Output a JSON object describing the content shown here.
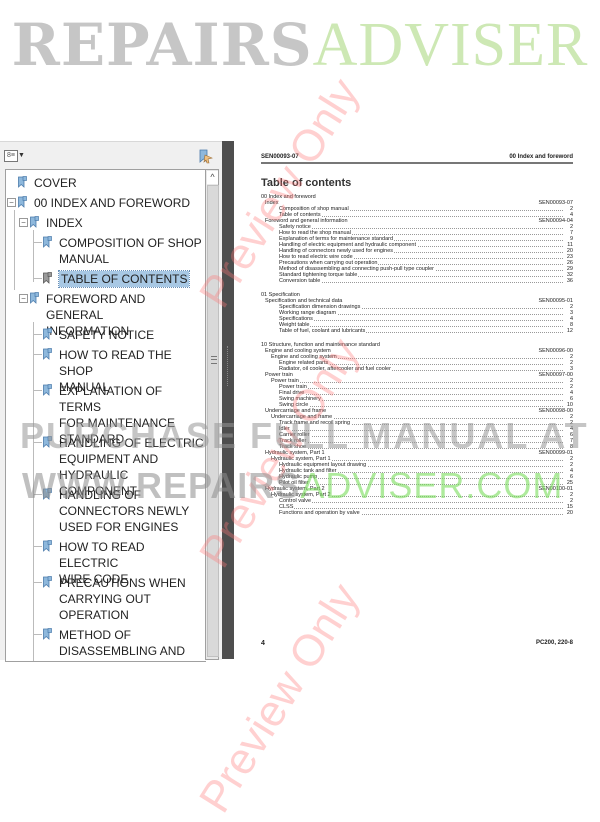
{
  "brand": {
    "part1": "REPAIRS",
    "part2": "ADVISER"
  },
  "watermarks": {
    "preview": "Preview Only",
    "purchase": "PURCHASE FULL MANUAL AT",
    "site_part1": "WWW.REPAIRS",
    "site_part2": "ADVISER.COM"
  },
  "bookmarks_panel": {
    "options_icon": "options-menu-icon",
    "tool_icon": "bookmark-tool-icon",
    "items": [
      {
        "label": "COVER",
        "level": 0
      },
      {
        "label": "00 INDEX AND FOREWORD",
        "level": 0,
        "expanded": true
      },
      {
        "label": "INDEX",
        "level": 1,
        "expanded": true
      },
      {
        "label": "COMPOSITION OF SHOP\nMANUAL",
        "level": 2
      },
      {
        "label": "TABLE OF CONTENTS",
        "level": 2,
        "selected": true
      },
      {
        "label": "FOREWORD AND GENERAL\nINFORMATION",
        "level": 1,
        "expanded": true
      },
      {
        "label": "SAFETY NOTICE",
        "level": 2
      },
      {
        "label": "HOW TO READ THE SHOP\nMANUAL",
        "level": 2
      },
      {
        "label": "EXPLANATION OF TERMS\nFOR MAINTENANCE\nSTANDARD",
        "level": 2
      },
      {
        "label": "HANDLING OF ELECTRIC\nEQUIPMENT AND\nHYDRAULIC COMPONENT",
        "level": 2
      },
      {
        "label": "HANDLING OF\nCONNECTORS NEWLY\nUSED FOR ENGINES",
        "level": 2
      },
      {
        "label": "HOW TO READ ELECTRIC\nWIRE CODE",
        "level": 2
      },
      {
        "label": "PRECAUTIONS WHEN\nCARRYING OUT\nOPERATION",
        "level": 2
      },
      {
        "label": "METHOD OF\nDISASSEMBLING AND",
        "level": 2
      }
    ]
  },
  "document": {
    "header_left": "SEN00093-07",
    "header_right": "00 Index and foreword",
    "title": "Table of contents",
    "footer_page": "4",
    "footer_model": "PC200, 220-8",
    "toc": [
      {
        "type": "section",
        "text": "00 Index and foreword"
      },
      {
        "type": "group",
        "text": "Index",
        "code": "SEN00093-07"
      },
      {
        "type": "entry",
        "indent": 2,
        "text": "Composition of shop manual",
        "page": "2"
      },
      {
        "type": "entry",
        "indent": 2,
        "text": "Table of contents",
        "page": "4"
      },
      {
        "type": "group",
        "text": "Foreword and general information",
        "code": "SEN00094-04"
      },
      {
        "type": "entry",
        "indent": 2,
        "text": "Safety notice",
        "page": "2"
      },
      {
        "type": "entry",
        "indent": 2,
        "text": "How to read the shop manual",
        "page": "7"
      },
      {
        "type": "entry",
        "indent": 2,
        "text": "Explanation of terms for maintenance standard",
        "page": "9"
      },
      {
        "type": "entry",
        "indent": 2,
        "text": "Handling of electric equipment and hydraulic component",
        "page": "11"
      },
      {
        "type": "entry",
        "indent": 2,
        "text": "Handling of connectors newly used for engines",
        "page": "20"
      },
      {
        "type": "entry",
        "indent": 2,
        "text": "How to read electric wire code",
        "page": "23"
      },
      {
        "type": "entry",
        "indent": 2,
        "text": "Precautions when carrying out operation",
        "page": "26"
      },
      {
        "type": "entry",
        "indent": 2,
        "text": "Method of disassembling and connecting push-pull type coupler",
        "page": "29"
      },
      {
        "type": "entry",
        "indent": 2,
        "text": "Standard tightening torque table",
        "page": "32"
      },
      {
        "type": "entry",
        "indent": 2,
        "text": "Conversion table",
        "page": "36"
      },
      {
        "type": "gap"
      },
      {
        "type": "section",
        "text": "01 Specification"
      },
      {
        "type": "group",
        "text": "Specification and technical data",
        "code": "SEN00095-01"
      },
      {
        "type": "entry",
        "indent": 2,
        "text": "Specification dimension drawings",
        "page": "2"
      },
      {
        "type": "entry",
        "indent": 2,
        "text": "Working range diagram",
        "page": "3"
      },
      {
        "type": "entry",
        "indent": 2,
        "text": "Specifications",
        "page": "4"
      },
      {
        "type": "entry",
        "indent": 2,
        "text": "Weight table",
        "page": "8"
      },
      {
        "type": "entry",
        "indent": 2,
        "text": "Table of fuel, coolant and lubricants",
        "page": "12"
      },
      {
        "type": "gap"
      },
      {
        "type": "section",
        "text": "10 Structure, function and maintenance standard"
      },
      {
        "type": "group",
        "text": "Engine and cooling system",
        "code": "SEN00096-00"
      },
      {
        "type": "entry",
        "indent": 1,
        "text": "Engine and cooling system",
        "page": "2"
      },
      {
        "type": "entry",
        "indent": 2,
        "text": "Engine related parts",
        "page": "2"
      },
      {
        "type": "entry",
        "indent": 2,
        "text": "Radiator, oil cooler, aftercooler and fuel cooler",
        "page": "3"
      },
      {
        "type": "group",
        "text": "Power train",
        "code": "SEN00097-00"
      },
      {
        "type": "entry",
        "indent": 1,
        "text": "Power train",
        "page": "2"
      },
      {
        "type": "entry",
        "indent": 2,
        "text": "Power train",
        "page": "2"
      },
      {
        "type": "entry",
        "indent": 2,
        "text": "Final drive",
        "page": "4"
      },
      {
        "type": "entry",
        "indent": 2,
        "text": "Swing machinery",
        "page": "6"
      },
      {
        "type": "entry",
        "indent": 2,
        "text": "Swing circle",
        "page": "10"
      },
      {
        "type": "group",
        "text": "Undercarriage and frame",
        "code": "SEN00098-00"
      },
      {
        "type": "entry",
        "indent": 1,
        "text": "Undercarriage and frame",
        "page": "2"
      },
      {
        "type": "entry",
        "indent": 2,
        "text": "Track frame and recoil spring",
        "page": "2"
      },
      {
        "type": "entry",
        "indent": 2,
        "text": "Idler",
        "page": "4"
      },
      {
        "type": "entry",
        "indent": 2,
        "text": "Carrier roller",
        "page": "6"
      },
      {
        "type": "entry",
        "indent": 2,
        "text": "Track roller",
        "page": "7"
      },
      {
        "type": "entry",
        "indent": 2,
        "text": "Track shoe",
        "page": "8"
      },
      {
        "type": "group",
        "text": "Hydraulic system, Part 1",
        "code": "SEN00099-01"
      },
      {
        "type": "entry",
        "indent": 1,
        "text": "Hydraulic system, Part 1",
        "page": "2"
      },
      {
        "type": "entry",
        "indent": 2,
        "text": "Hydraulic equipment layout drawing",
        "page": "2"
      },
      {
        "type": "entry",
        "indent": 2,
        "text": "Hydraulic tank and filter",
        "page": "4"
      },
      {
        "type": "entry",
        "indent": 2,
        "text": "Hydraulic pump",
        "page": "6"
      },
      {
        "type": "entry",
        "indent": 2,
        "text": "Pilot oil filter",
        "page": "25"
      },
      {
        "type": "group",
        "text": "Hydraulic system, Part 2",
        "code": "SEN00100-01"
      },
      {
        "type": "entry",
        "indent": 1,
        "text": "Hydraulic system, Part 2",
        "page": "2"
      },
      {
        "type": "entry",
        "indent": 2,
        "text": "Control valve",
        "page": "2"
      },
      {
        "type": "entry",
        "indent": 2,
        "text": "CLSS",
        "page": "15"
      },
      {
        "type": "entry",
        "indent": 2,
        "text": "Functions and operation by valve",
        "page": "20"
      }
    ]
  }
}
